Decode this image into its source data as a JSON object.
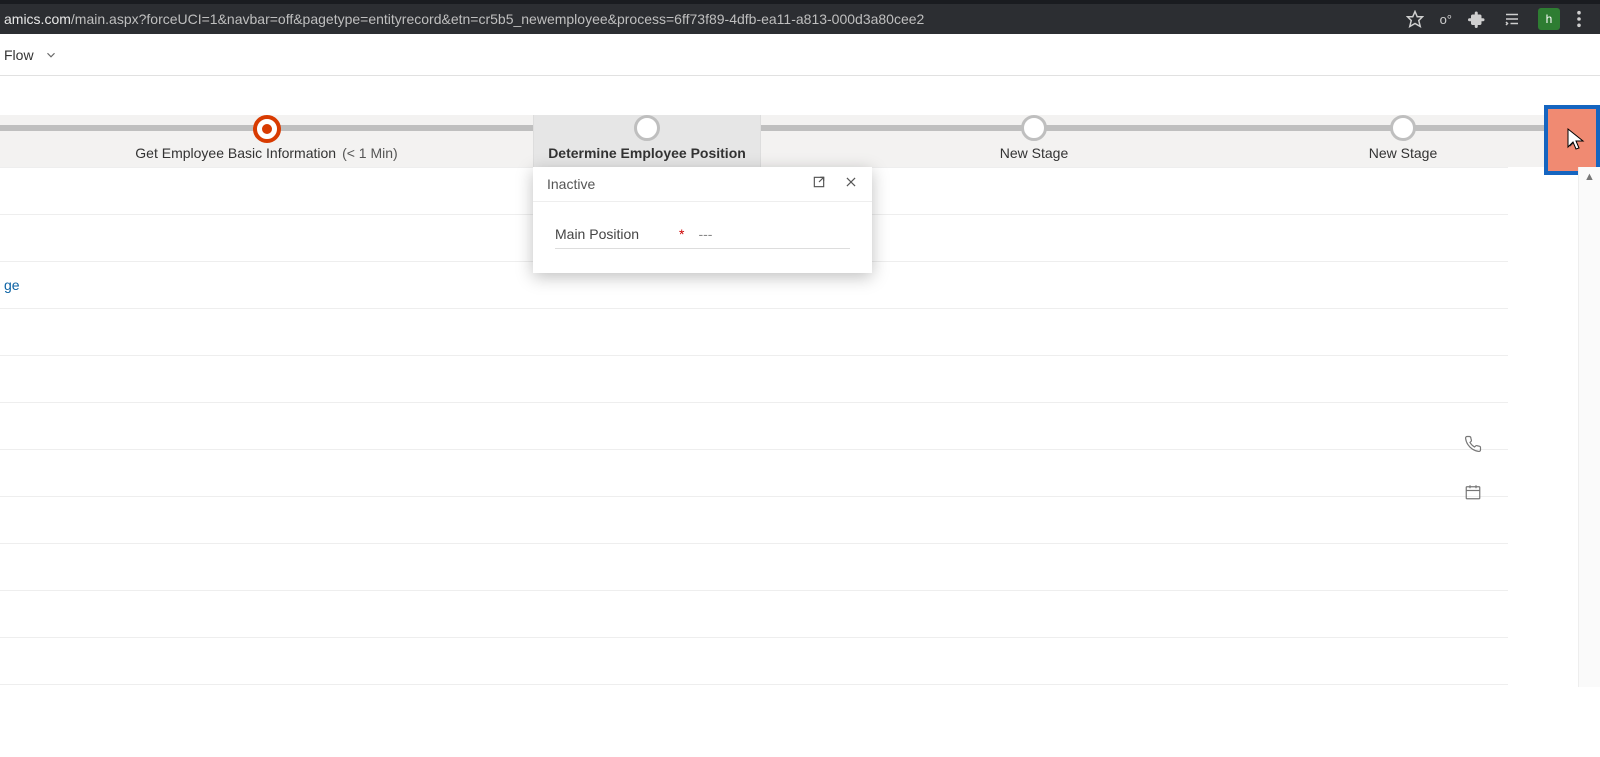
{
  "chrome": {
    "url_domain_fragment": "amics.com",
    "url_path": "/main.aspx?forceUCI=1&navbar=off&pagetype=entityrecord&etn=cr5b5_newemployee&process=6ff73f89-4dfb-ea11-a813-000d3a80cee2",
    "avatar_letter": "h"
  },
  "flow": {
    "label": "Flow"
  },
  "bpf": {
    "stages": [
      {
        "title": "Get Employee Basic Information",
        "time": "(< 1 Min)",
        "state": "completed"
      },
      {
        "title": "Determine Employee Position",
        "time": "",
        "state": "active"
      },
      {
        "title": "New Stage",
        "time": "",
        "state": "future"
      },
      {
        "title": "New Stage",
        "time": "",
        "state": "future"
      }
    ]
  },
  "flyout": {
    "status": "Inactive",
    "field_label": "Main Position",
    "field_value": "---"
  },
  "form": {
    "link_text_fragment": "ge"
  }
}
